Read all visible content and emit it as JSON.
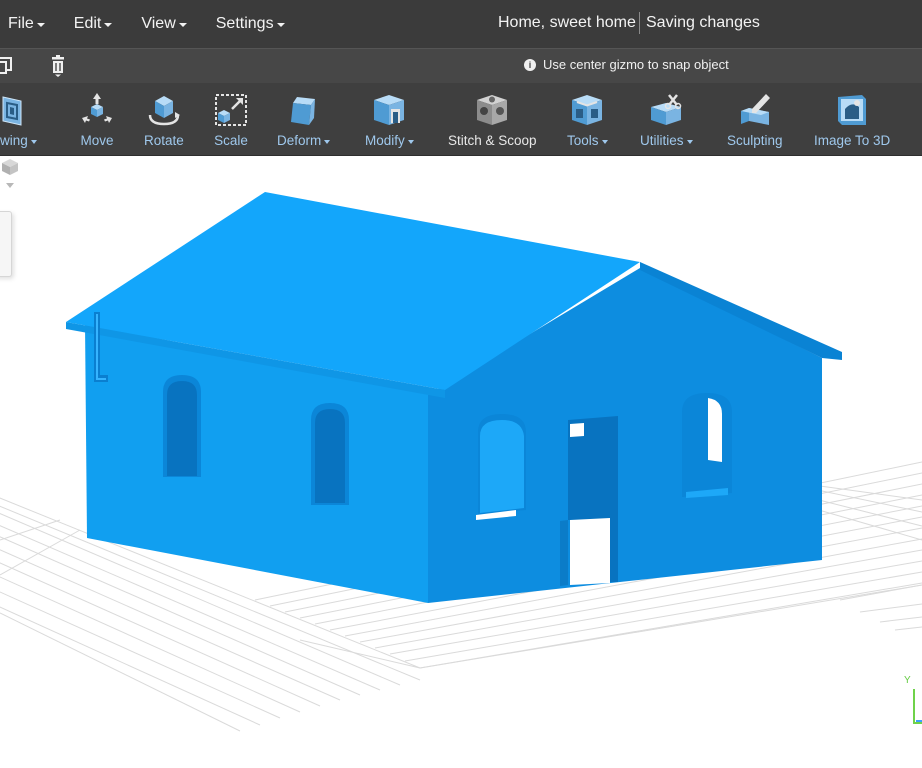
{
  "menu": {
    "items": [
      {
        "label": "File"
      },
      {
        "label": "Edit"
      },
      {
        "label": "View"
      },
      {
        "label": "Settings"
      }
    ]
  },
  "header": {
    "document_title": "Home, sweet home",
    "save_status": "Saving changes"
  },
  "actionbar": {
    "hint": "Use center gizmo to snap object",
    "hint_icon": "info-icon",
    "copy_icon": "duplicate-icon",
    "delete_icon": "trash-icon"
  },
  "toolbar": {
    "tools": [
      {
        "label": "rawing",
        "icon": "drawing-icon",
        "dropdown": true
      },
      {
        "label": "Move",
        "icon": "move-icon",
        "dropdown": false
      },
      {
        "label": "Rotate",
        "icon": "rotate-icon",
        "dropdown": false
      },
      {
        "label": "Scale",
        "icon": "scale-icon",
        "dropdown": false
      },
      {
        "label": "Deform",
        "icon": "deform-icon",
        "dropdown": true
      },
      {
        "label": "Modify",
        "icon": "modify-icon",
        "dropdown": true
      },
      {
        "label": "Stitch & Scoop",
        "icon": "stitch-scoop-icon",
        "dropdown": false
      },
      {
        "label": "Tools",
        "icon": "tools-icon",
        "dropdown": true
      },
      {
        "label": "Utilities",
        "icon": "utilities-icon",
        "dropdown": true
      },
      {
        "label": "Sculpting",
        "icon": "sculpting-icon",
        "dropdown": false
      },
      {
        "label": "Image To 3D",
        "icon": "image-to-3d-icon",
        "dropdown": false
      }
    ]
  },
  "viewport": {
    "axis_label_y": "Y",
    "model_color": "#11a0f0",
    "grid_color": "#d9d9d9"
  },
  "colors": {
    "menubar_bg": "#3b3b3b",
    "ribbon_bg": "#3f3f3f",
    "tool_label": "#9fc8ec",
    "tool_icon": "#7ab4e2"
  }
}
